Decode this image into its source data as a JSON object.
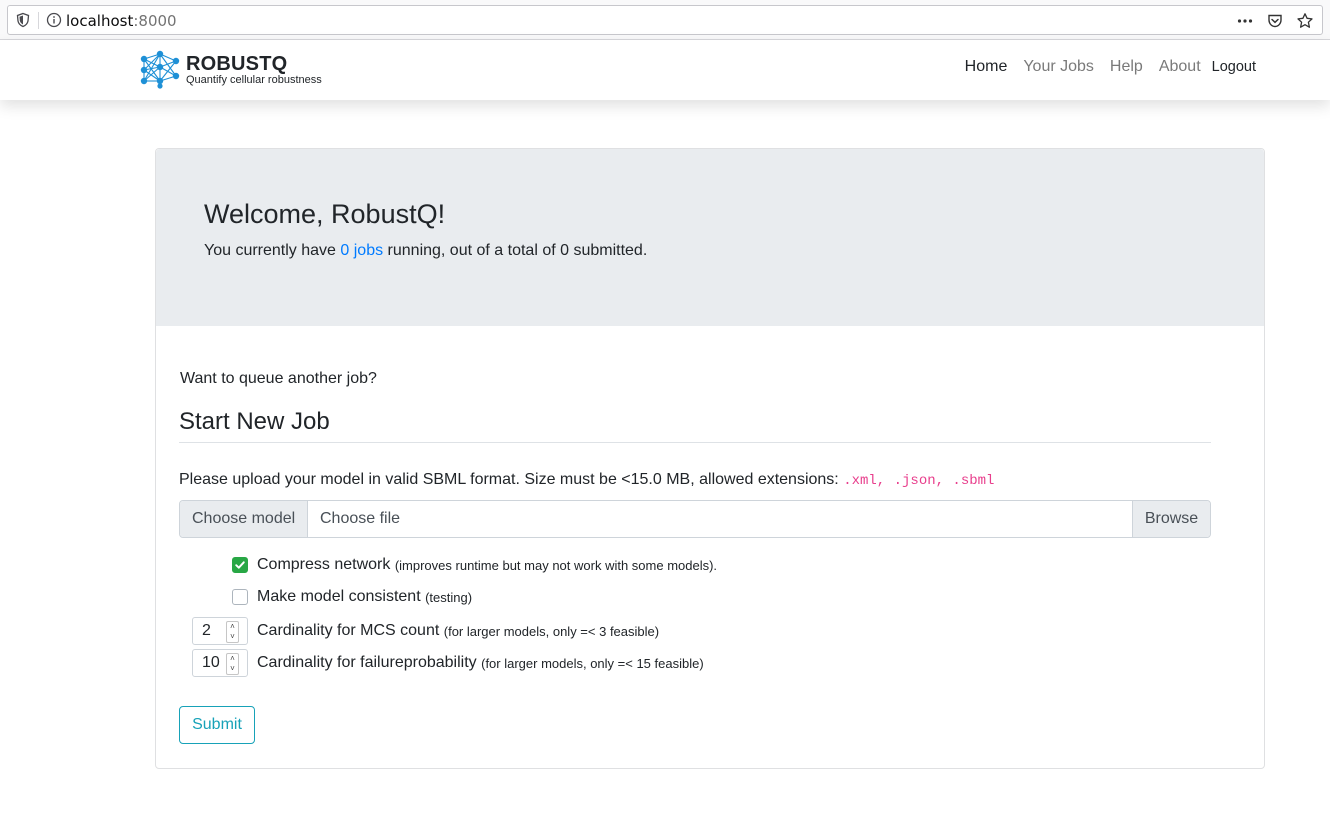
{
  "browser": {
    "url_host": "localhost",
    "url_port": ":8000",
    "icons": [
      "shield-icon",
      "info-icon",
      "more-icon",
      "pocket-icon",
      "bookmark-star-icon"
    ]
  },
  "navbar": {
    "brand_title": "ROBUSTQ",
    "brand_subtitle": "Quantify cellular robustness",
    "links": [
      {
        "label": "Home",
        "active": true
      },
      {
        "label": "Your Jobs",
        "active": false
      },
      {
        "label": "Help",
        "active": false
      },
      {
        "label": "About",
        "active": false
      },
      {
        "label": "Logout",
        "active": false
      }
    ]
  },
  "welcome": {
    "title": "Welcome, RobustQ!",
    "text_before": "You currently have ",
    "jobs_link": "0 jobs",
    "text_after": " running, out of a total of 0 submitted."
  },
  "form": {
    "queue_prompt": "Want to queue another job?",
    "section_title": "Start New Job",
    "upload_text": "Please upload your model in valid SBML format. Size must be <15.0 MB, allowed extensions:",
    "extensions": ".xml, .json, .sbml",
    "file_prepend": "Choose model",
    "file_placeholder": "Choose file",
    "file_browse": "Browse",
    "compress_label": "Compress network",
    "compress_note": "(improves runtime but may not work with some models).",
    "compress_checked": true,
    "consistent_label": "Make model consistent",
    "consistent_note": "(testing)",
    "consistent_checked": false,
    "mcs_value": "2",
    "mcs_label": "Cardinality for MCS count",
    "mcs_note": "(for larger models, only =< 3 feasible)",
    "fail_value": "10",
    "fail_label": "Cardinality for failureprobability",
    "fail_note": "(for larger models, only =< 15 feasible)",
    "submit_label": "Submit"
  },
  "colors": {
    "link": "#007bff",
    "checkbox_checked": "#28a745",
    "submit": "#17a2b8",
    "code": "#e83e8c",
    "jumbotron": "#e9ecef"
  }
}
